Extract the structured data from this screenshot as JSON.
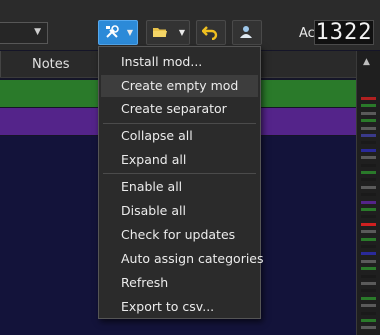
{
  "toolbar": {
    "active_label": "Active:",
    "active_count": "1322",
    "tools_icon": "tools-icon",
    "folder_icon": "folder-icon",
    "undo_icon": "undo-arrow-icon",
    "profile_icon": "profile-icon",
    "accent": "#2c8ad8"
  },
  "columns": {
    "notes": "Notes"
  },
  "rows": [
    {
      "color": "#2a7a2a"
    },
    {
      "color": "#54248a"
    }
  ],
  "menu": {
    "items": [
      "Install mod...",
      "Create empty mod",
      "Create separator",
      "Collapse all",
      "Expand all",
      "Enable all",
      "Disable all",
      "Check for updates",
      "Auto assign categories",
      "Refresh",
      "Export to csv..."
    ],
    "highlighted": "Create empty mod"
  },
  "scrollbar": {
    "markers": [
      "#b02020",
      "#2a7a2a",
      "#5a5a5a",
      "#2a7a2a",
      "#5a5a5a",
      "#3a3a8a",
      "#1a1a1a",
      "#2a2a9a",
      "#5a5a5a",
      "#1a1a1a",
      "#2a7a2a",
      "#1a1a1a",
      "#5a5a5a",
      "#1a1a1a",
      "#54248a",
      "#2a7a2a",
      "#1a1a1a",
      "#d02020",
      "#5a5a5a",
      "#2a7a2a",
      "#1a1a1a",
      "#2a2a9a",
      "#5a5a5a",
      "#2a7a2a",
      "#1a1a1a",
      "#5a5a5a",
      "#1a1a1a",
      "#2a7a2a",
      "#5a5a5a",
      "#1a1a1a",
      "#2a7a2a",
      "#5a5a5a"
    ]
  }
}
